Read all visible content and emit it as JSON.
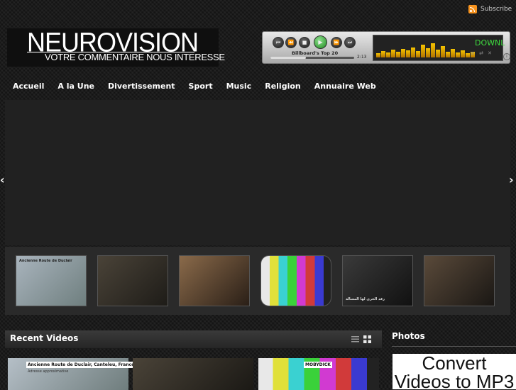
{
  "header": {
    "subscribe_label": "Subscribe",
    "logo_title": "NEUROVISION",
    "logo_tagline": "VOTRE COMMENTAIRE NOUS INTERESSE"
  },
  "player": {
    "track_title": "Billboard's Top 20",
    "time": "2:13",
    "screen_text": "DOWNL",
    "progress": 0.42,
    "buttons": [
      "skip-back",
      "rewind",
      "stop",
      "play",
      "fast-forward",
      "skip-forward"
    ],
    "button_glyphs": [
      "⏮",
      "⏪",
      "■",
      "▶",
      "⏩",
      "⏭"
    ]
  },
  "nav": {
    "items": [
      "Accueil",
      "A la Une",
      "Divertissement",
      "Sport",
      "Music",
      "Religion",
      "Annuaire Web"
    ]
  },
  "slider": {
    "prev_glyph": "‹",
    "next_glyph": "›",
    "thumbs": [
      {
        "name": "road-map",
        "caption": "Ancienne Route de Duclair",
        "colors": [
          "#a9b4bd",
          "#6f7f7f"
        ]
      },
      {
        "name": "church-choir",
        "caption": "",
        "colors": [
          "#4a4338",
          "#1e1c18"
        ]
      },
      {
        "name": "tv-hosts",
        "caption": "",
        "colors": [
          "#8a6a4a",
          "#2a1f17"
        ]
      },
      {
        "name": "test-pattern",
        "caption": "",
        "colors": [
          "#d1d1d1",
          "#888888"
        ]
      },
      {
        "name": "dark-stage",
        "caption": "رقد الحرى لها المسالة",
        "colors": [
          "#3a3a3a",
          "#111111"
        ]
      },
      {
        "name": "interview-room",
        "caption": "",
        "colors": [
          "#5a4a3a",
          "#1a1714"
        ]
      }
    ]
  },
  "recent_videos": {
    "title": "Recent Videos",
    "items": [
      {
        "name": "road-map-video",
        "caption": "Ancienne Route de Duclair, Canteleu, France",
        "sub": "Adresse approximative"
      },
      {
        "name": "church-video",
        "caption": ""
      },
      {
        "name": "mobydick-video",
        "caption": "MOBYDICK"
      }
    ]
  },
  "photos": {
    "title": "Photos",
    "ad_text": "Convert Videos to MP3"
  },
  "colors": {
    "background": "#1b1b1b",
    "slider_bg": "#212121",
    "accent_green": "#3fdc3f",
    "equalizer": "#f5c300",
    "rss": "#f7931e"
  }
}
